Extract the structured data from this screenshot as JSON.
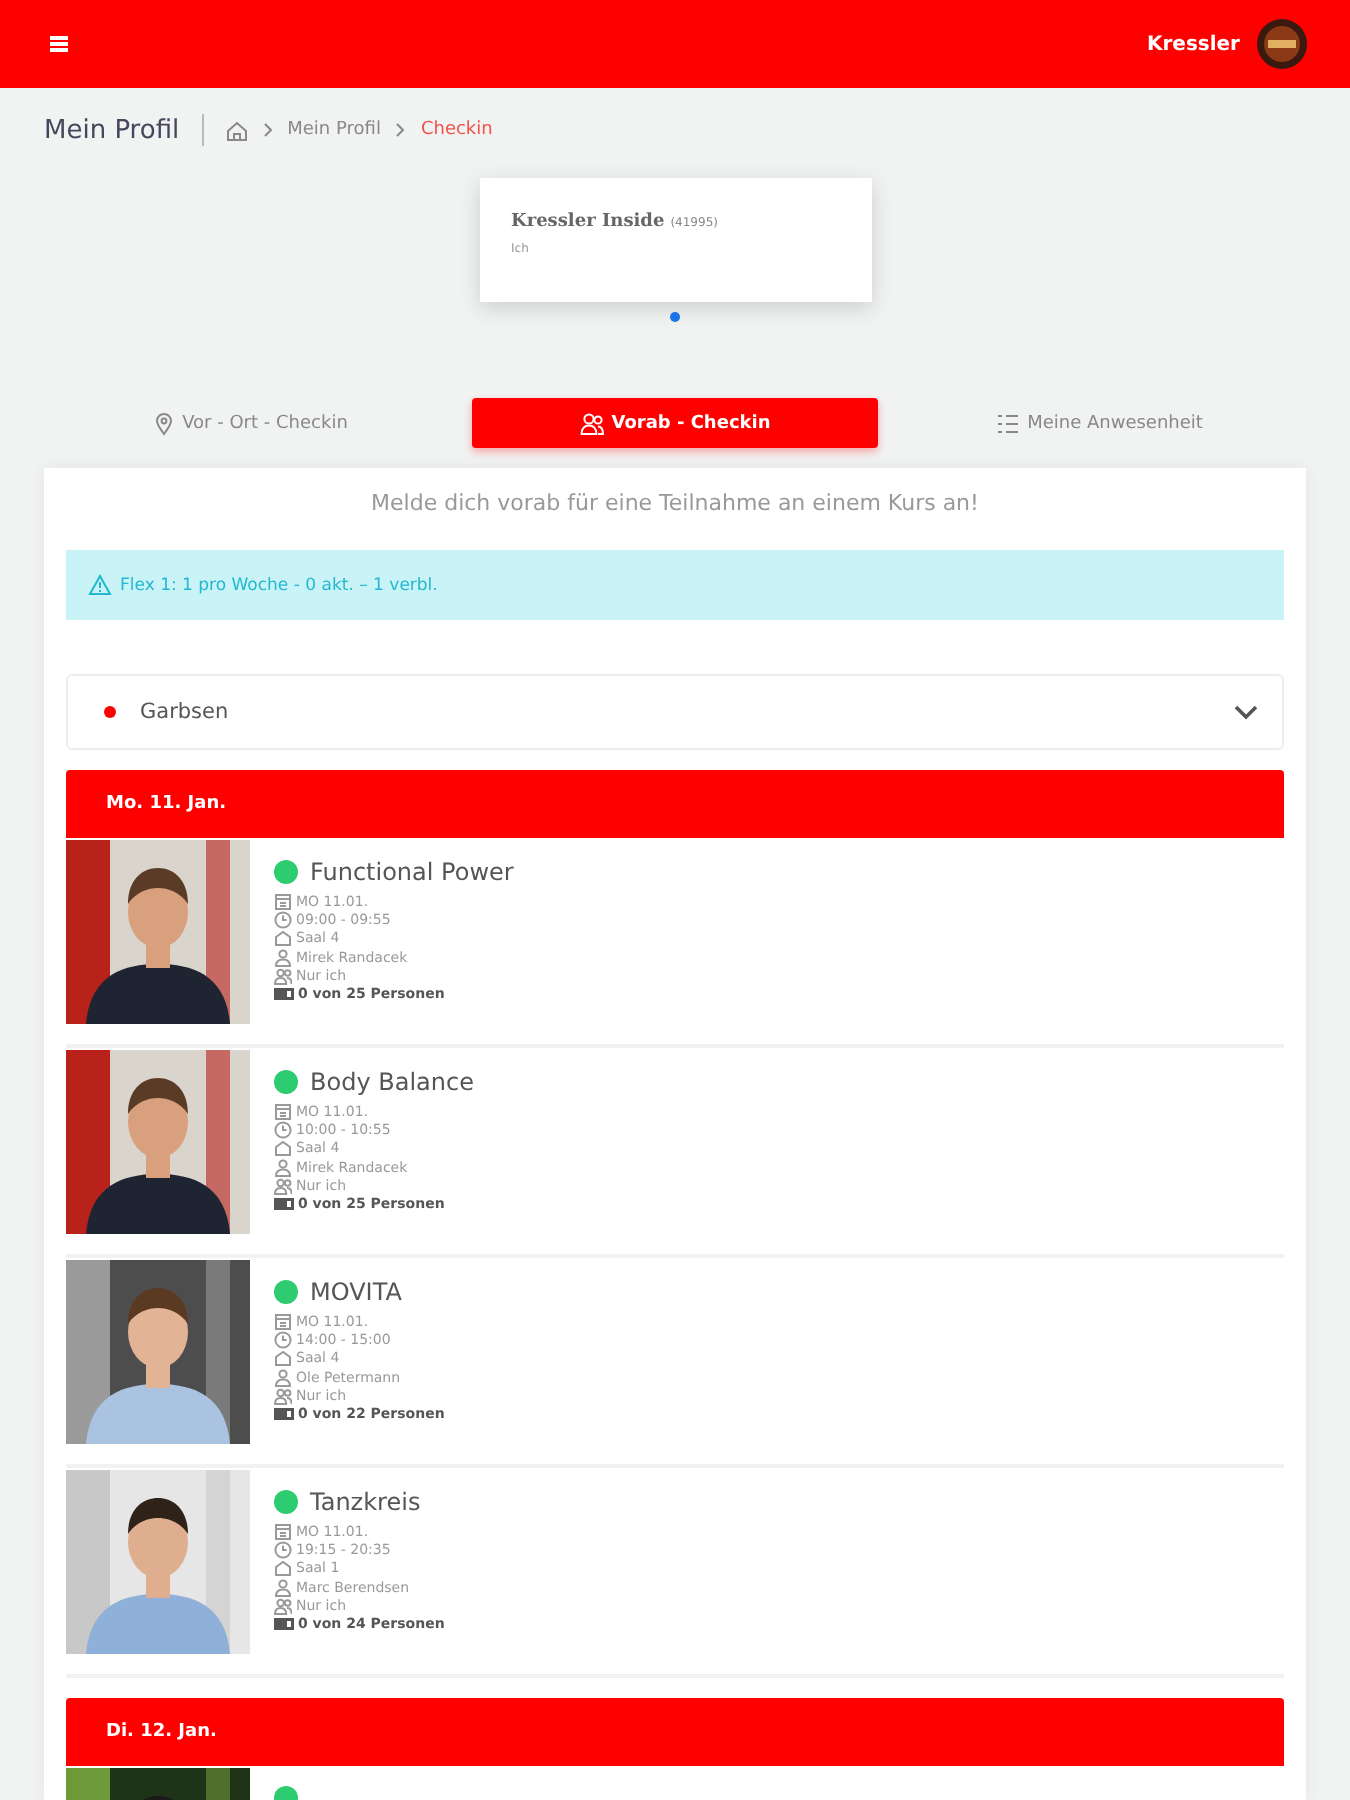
{
  "header": {
    "user": "Kressler"
  },
  "breadcrumb": {
    "title": "Mein Profil",
    "items": [
      {
        "kind": "home"
      },
      {
        "kind": "link",
        "label": "Mein Profil"
      },
      {
        "kind": "current",
        "label": "Checkin"
      }
    ]
  },
  "membership_card": {
    "name": "Kressler Inside",
    "number": "(41995)",
    "subtitle": "Ich"
  },
  "carousel_dots": [
    {
      "selected": true
    }
  ],
  "tabs": [
    {
      "label": "Vor - Ort - Checkin",
      "selected": false
    },
    {
      "label": "Vorab - Checkin",
      "selected": true
    },
    {
      "label": "Meine Anwesenheit",
      "selected": false
    }
  ],
  "intro": "Melde dich vorab für eine Teilnahme an einem Kurs an!",
  "alert": "Flex 1: 1 pro Woche - 0 akt. – 1 verbl.",
  "location_select": {
    "value": "Garbsen",
    "color": "#ff0000"
  },
  "days": [
    {
      "label": "Mo. 11. Jan.",
      "courses": [
        {
          "title": "Functional Power",
          "color": "#2ecc71",
          "date": "MO 11.01.",
          "time": "09:00 - 09:55",
          "room": "Saal 4",
          "trainer": "Mirek Randacek",
          "who": "Nur ich",
          "capacity": "0 von 25 Personen"
        },
        {
          "title": "Body Balance",
          "color": "#2ecc71",
          "date": "MO 11.01.",
          "time": "10:00 - 10:55",
          "room": "Saal 4",
          "trainer": "Mirek Randacek",
          "who": "Nur ich",
          "capacity": "0 von 25 Personen"
        },
        {
          "title": "MOVITA",
          "color": "#2ecc71",
          "date": "MO 11.01.",
          "time": "14:00 - 15:00",
          "room": "Saal 4",
          "trainer": "Ole Petermann",
          "who": "Nur ich",
          "capacity": "0 von 22 Personen"
        },
        {
          "title": "Tanzkreis",
          "color": "#2ecc71",
          "date": "MO 11.01.",
          "time": "19:15 - 20:35",
          "room": "Saal 1",
          "trainer": "Marc Berendsen",
          "who": "Nur ich",
          "capacity": "0 von 24 Personen"
        }
      ]
    },
    {
      "label": "Di. 12. Jan.",
      "courses": [
        {
          "color": "#2ecc71"
        }
      ]
    }
  ]
}
